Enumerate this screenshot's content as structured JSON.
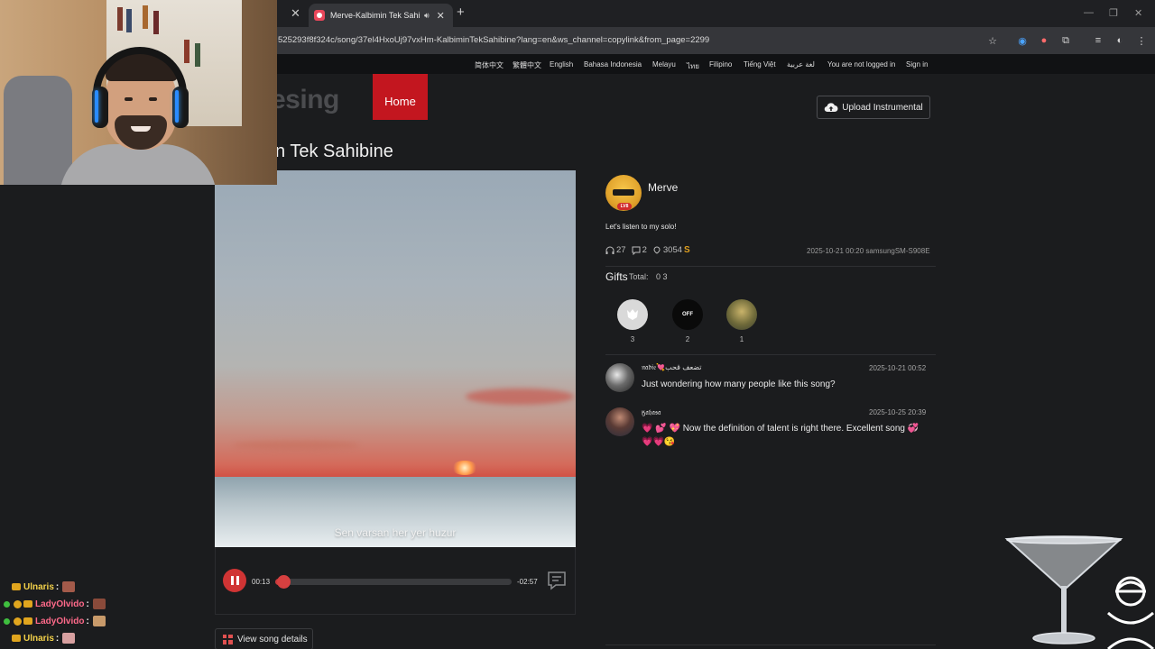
{
  "browser": {
    "active_tab_title": "Merve-Kalbimin Tek Sahibine",
    "url": "525293f8f324c/song/37el4HxoUj97vxHm-KalbiminTekSahibine?lang=en&ws_channel=copylink&from_page=2299"
  },
  "langbar": {
    "languages": [
      "简体中文",
      "繁體中文",
      "English",
      "Bahasa Indonesia",
      "Melayu",
      "ไทย",
      "Filipino",
      "Tiếng Việt",
      "لغة عربية"
    ],
    "login_status": "You are not logged in",
    "sign_in": "Sign in"
  },
  "header": {
    "logo_partial": "esing",
    "home_label": "Home",
    "upload_label": "Upload Instrumental"
  },
  "song": {
    "title_partial": "n Tek Sahibine",
    "lyric_line": "Sen varsan her yer huzur",
    "current_time": "00:13",
    "remaining_time": "-02:57",
    "progress": 0.035,
    "details_label": "View song details"
  },
  "author": {
    "name": "Merve",
    "avatar_badge": "LV8",
    "description": "Let's listen to my solo!",
    "listens": "27",
    "comments": "2",
    "likes": "3054",
    "coin_symbol": "S",
    "posted": "2025-10-21 00:20 samsungSM-S908E"
  },
  "gifts": {
    "title": "Gifts",
    "total_label": "Total:",
    "total_values": "0  3",
    "items": [
      {
        "icon": "flower-gift-icon",
        "count": "3"
      },
      {
        "icon": "off-gift-icon",
        "label": "OFF",
        "count": "2"
      },
      {
        "icon": "photo-gift-icon",
        "count": "1"
      }
    ]
  },
  "comments": [
    {
      "name": "𝔫𝔞𝔡𝔦𝔢💘تضعف قحب",
      "date": "2025-10-21 00:52",
      "text": "Just wondering how many people like this song?"
    },
    {
      "name": "ӄ𝔞𝔥𝔞𝔰𝔞",
      "date": "2025-10-25 20:39",
      "text_before": "💗 💕 💖",
      "text": "Now the definition of talent is right there. Excellent song",
      "text_after": "💞 💗💗😘"
    }
  ],
  "stream_chat": [
    {
      "user": "Ulnaris",
      "sep": ":",
      "color": "#f4d24a"
    },
    {
      "user": "LadyOlvido",
      "sep": ":",
      "color": "#ff6a8a"
    },
    {
      "user": "LadyOlvido",
      "sep": ":",
      "color": "#ff6a8a"
    },
    {
      "user": "Ulnaris",
      "sep": ":",
      "color": "#f4d24a"
    }
  ],
  "colors": {
    "accent_red": "#c3161f",
    "progress_red": "#d64040",
    "background": "#1b1c1e"
  }
}
